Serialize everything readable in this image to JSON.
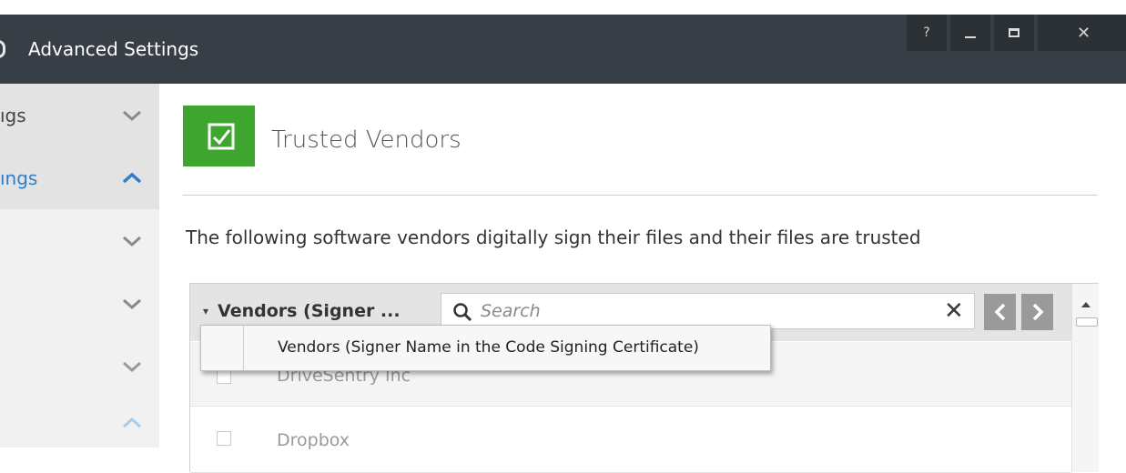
{
  "window": {
    "title": "Advanced Settings",
    "controls": {
      "help": "?",
      "close": "✕"
    }
  },
  "sidebar": {
    "items": [
      {
        "label": "ıgs",
        "expanded": false
      },
      {
        "label": "ıngs",
        "expanded": true
      },
      {
        "label": "",
        "expanded": false
      },
      {
        "label": "",
        "expanded": false
      },
      {
        "label": "",
        "expanded": false
      },
      {
        "label": "",
        "expanded": true
      }
    ],
    "accent": "#2c7fc9"
  },
  "main": {
    "header_title": "Trusted Vendors",
    "header_icon_color": "#3ea62f",
    "description": "The following software vendors digitally sign their files and their files are trusted"
  },
  "table": {
    "column_header": "Vendors (Signer ...",
    "search_placeholder": "Search",
    "rows": [
      {
        "label": "DriveSentry Inc",
        "checked": false
      },
      {
        "label": "Dropbox",
        "checked": false
      }
    ]
  },
  "dropdown": {
    "option_label": "Vendors (Signer Name in the Code Signing Certificate)"
  }
}
